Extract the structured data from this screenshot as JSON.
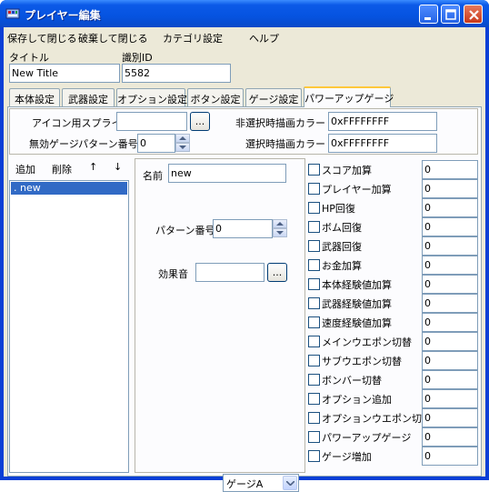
{
  "window": {
    "title": "プレイヤー編集"
  },
  "menu": [
    "保存して閉じる",
    "破棄して閉じる",
    "カテゴリ設定",
    "ヘルプ"
  ],
  "header": {
    "title_label": "タイトル",
    "title_value": "New Title",
    "id_label": "識別ID",
    "id_value": "5582"
  },
  "tabs": [
    "本体設定",
    "武器設定",
    "オプション設定",
    "ボタン設定",
    "ゲージ設定",
    "パワーアップゲージ"
  ],
  "gauge_settings": {
    "icon_sprite_label": "アイコン用スプライト",
    "icon_sprite_value": "",
    "browse_label": "...",
    "disabled_pattern_label": "無効ゲージパターン番号",
    "disabled_pattern_value": "0",
    "unselected_color_label": "非選択時描画カラー",
    "unselected_color_value": "0xFFFFFFFF",
    "selected_color_label": "選択時描画カラー",
    "selected_color_value": "0xFFFFFFFF"
  },
  "list_toolbar": {
    "add": "追加",
    "delete": "削除",
    "up": "↑",
    "down": "↓"
  },
  "list_items": [
    ". new"
  ],
  "detail": {
    "name_label": "名前",
    "name_value": "new",
    "pattern_label": "パターン番号",
    "pattern_value": "0",
    "sound_label": "効果音",
    "sound_value": "",
    "browse_label": "...",
    "gauge_select_value": "ゲージA"
  },
  "effects": [
    {
      "label": "スコア加算",
      "value": "0"
    },
    {
      "label": "プレイヤー加算",
      "value": "0"
    },
    {
      "label": "HP回復",
      "value": "0"
    },
    {
      "label": "ボム回復",
      "value": "0"
    },
    {
      "label": "武器回復",
      "value": "0"
    },
    {
      "label": "お金加算",
      "value": "0"
    },
    {
      "label": "本体経験値加算",
      "value": "0"
    },
    {
      "label": "武器経験値加算",
      "value": "0"
    },
    {
      "label": "速度経験値加算",
      "value": "0"
    },
    {
      "label": "メインウエポン切替",
      "value": "0"
    },
    {
      "label": "サブウエポン切替",
      "value": "0"
    },
    {
      "label": "ボンバー切替",
      "value": "0"
    },
    {
      "label": "オプション追加",
      "value": "0"
    },
    {
      "label": "オプションウエポン切替",
      "value": "0"
    },
    {
      "label": "パワーアップゲージ",
      "value": "0"
    },
    {
      "label": "ゲージ増加",
      "value": "0"
    }
  ]
}
